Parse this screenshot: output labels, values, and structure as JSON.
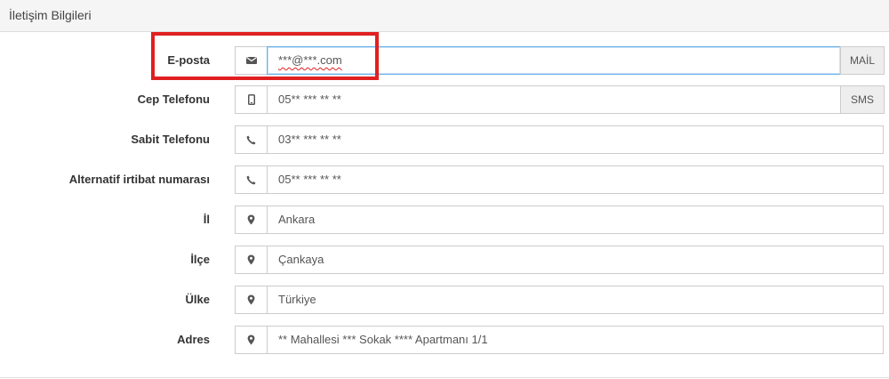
{
  "panel": {
    "title": "İletişim Bilgileri"
  },
  "fields": [
    {
      "label": "E-posta",
      "icon": "envelope-icon",
      "value": "***@***.com",
      "button": "MAİL"
    },
    {
      "label": "Cep Telefonu",
      "icon": "mobile-phone-icon",
      "value": "05** *** ** **",
      "button": "SMS"
    },
    {
      "label": "Sabit Telefonu",
      "icon": "phone-icon",
      "value": "03** *** ** **"
    },
    {
      "label": "Alternatif irtibat numarası",
      "icon": "phone-icon",
      "value": "05** *** ** **"
    },
    {
      "label": "İl",
      "icon": "map-marker-icon",
      "value": "Ankara"
    },
    {
      "label": "İlçe",
      "icon": "map-marker-icon",
      "value": "Çankaya"
    },
    {
      "label": "Ülke",
      "icon": "map-marker-icon",
      "value": "Türkiye"
    },
    {
      "label": "Adres",
      "icon": "map-marker-icon",
      "value": "** Mahallesi *** Sokak **** Apartmanı 1/1"
    }
  ],
  "colors": {
    "highlight": "#e02020",
    "focus_border": "#66afe9",
    "addon_bg": "#eeeeee"
  }
}
